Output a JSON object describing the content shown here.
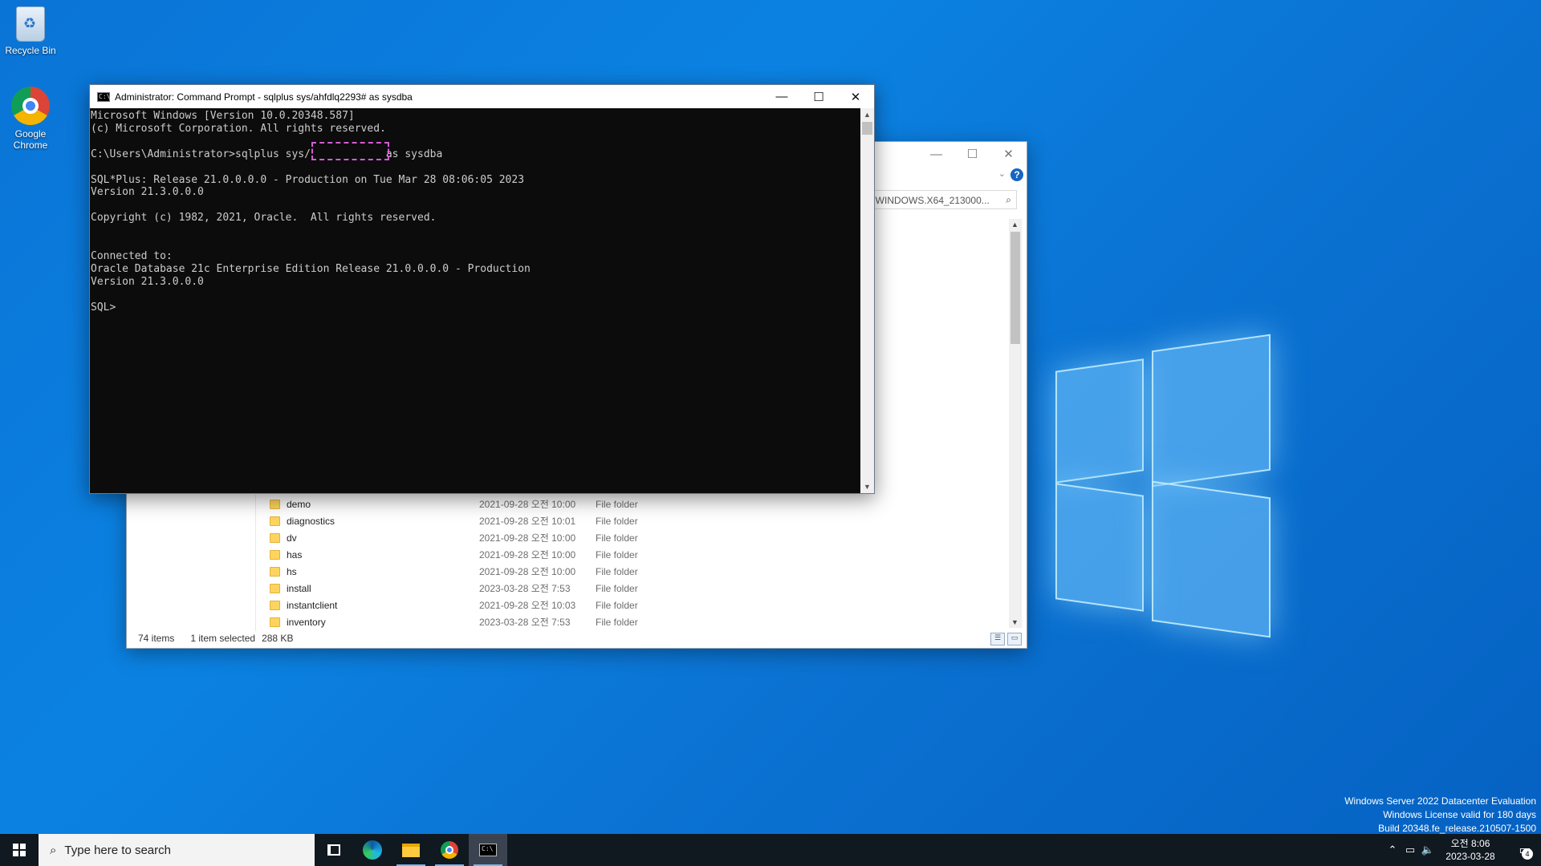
{
  "desktop": {
    "icons": [
      {
        "label": "Recycle Bin",
        "icon": "recycle-bin-icon"
      },
      {
        "label": "Google\nChrome",
        "icon": "chrome-icon"
      }
    ],
    "watermark": {
      "line1": "Windows Server 2022 Datacenter Evaluation",
      "line2": "Windows License valid for 180 days",
      "line3": "Build 20348.fe_release.210507-1500"
    }
  },
  "cmd": {
    "title": "Administrator: Command Prompt - sqlplus  sys/ahfdlq2293# as sysdba",
    "controls": {
      "minimize": "—",
      "maximize": "☐",
      "close": "✕"
    },
    "lines": [
      "Microsoft Windows [Version 10.0.20348.587]",
      "(c) Microsoft Corporation. All rights reserved.",
      "",
      "C:\\Users\\Administrator>sqlplus sys/            as sysdba",
      "",
      "SQL*Plus: Release 21.0.0.0.0 - Production on Tue Mar 28 08:06:05 2023",
      "Version 21.3.0.0.0",
      "",
      "Copyright (c) 1982, 2021, Oracle.  All rights reserved.",
      "",
      "",
      "Connected to:",
      "Oracle Database 21c Enterprise Edition Release 21.0.0.0.0 - Production",
      "Version 21.3.0.0.0",
      "",
      "SQL>"
    ]
  },
  "explorer": {
    "controls": {
      "minimize": "—",
      "maximize": "☐",
      "close": "✕"
    },
    "help": "?",
    "search_placeholder": "arch WINDOWS.X64_213000...",
    "files": [
      {
        "name": "demo",
        "date": "2021-09-28 오전 10:00",
        "type": "File folder"
      },
      {
        "name": "diagnostics",
        "date": "2021-09-28 오전 10:01",
        "type": "File folder"
      },
      {
        "name": "dv",
        "date": "2021-09-28 오전 10:00",
        "type": "File folder"
      },
      {
        "name": "has",
        "date": "2021-09-28 오전 10:00",
        "type": "File folder"
      },
      {
        "name": "hs",
        "date": "2021-09-28 오전 10:00",
        "type": "File folder"
      },
      {
        "name": "install",
        "date": "2023-03-28 오전 7:53",
        "type": "File folder"
      },
      {
        "name": "instantclient",
        "date": "2021-09-28 오전 10:03",
        "type": "File folder"
      },
      {
        "name": "inventory",
        "date": "2023-03-28 오전 7:53",
        "type": "File folder"
      }
    ],
    "status": {
      "items": "74 items",
      "selected": "1 item selected",
      "size": "288 KB"
    }
  },
  "taskbar": {
    "search_placeholder": "Type here to search",
    "apps": [
      "task-view-icon",
      "edge-icon",
      "file-explorer-icon",
      "chrome-icon",
      "command-prompt-icon"
    ],
    "clock": {
      "time": "오전 8:06",
      "date": "2023-03-28"
    },
    "notifications_count": "4"
  }
}
